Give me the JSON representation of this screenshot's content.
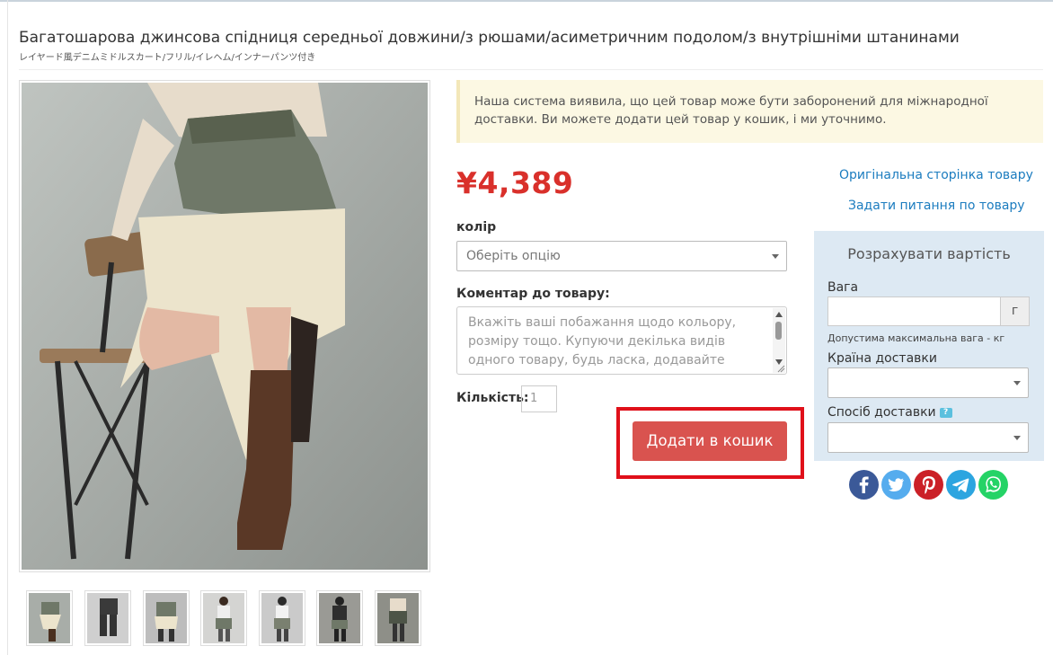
{
  "product": {
    "title": "Багатошарова джинсова спідниця середньої довжини/з рюшами/асиметричним подолом/з внутрішніми штанинами",
    "subtitle": "レイヤード風デニムミドルスカート/フリル/イレヘム/インナーパンツ付き",
    "price": "¥4,389"
  },
  "notice": {
    "text": "Наша система виявила, що цей товар може бути заборонений для міжнародної доставки. Ви можете додати цей товар у кошик, і ми уточнимо."
  },
  "options": {
    "color_label": "колір",
    "color_placeholder": "Оберіть опцію",
    "comment_label": "Коментар до товару:",
    "comment_placeholder": "Вкажіть ваші побажання щодо кольору, розміру тощо. Купуючи декілька видів одного товару, будь ласка, додавайте кожен з них в",
    "quantity_label": "Кількість:",
    "quantity_value": "1",
    "add_to_cart": "Додати в кошик"
  },
  "links": {
    "original_page": "Оригінальна сторінка товару",
    "ask_question": "Задати питання по товару"
  },
  "calculator": {
    "title": "Розрахувати вартість",
    "weight_label": "Вага",
    "weight_unit": "г",
    "weight_hint": "Допустима максимальна вага - кг",
    "country_label": "Країна доставки",
    "method_label": "Спосіб доставки",
    "help_glyph": "?"
  },
  "social": [
    {
      "name": "facebook",
      "color": "#3b5998",
      "glyph": "f"
    },
    {
      "name": "twitter",
      "color": "#55acee",
      "glyph": ""
    },
    {
      "name": "pinterest",
      "color": "#cb2027",
      "glyph": "P"
    },
    {
      "name": "telegram",
      "color": "#2ca5e0",
      "glyph": ""
    },
    {
      "name": "whatsapp",
      "color": "#25d366",
      "glyph": ""
    }
  ],
  "thumbnails_count": 7
}
